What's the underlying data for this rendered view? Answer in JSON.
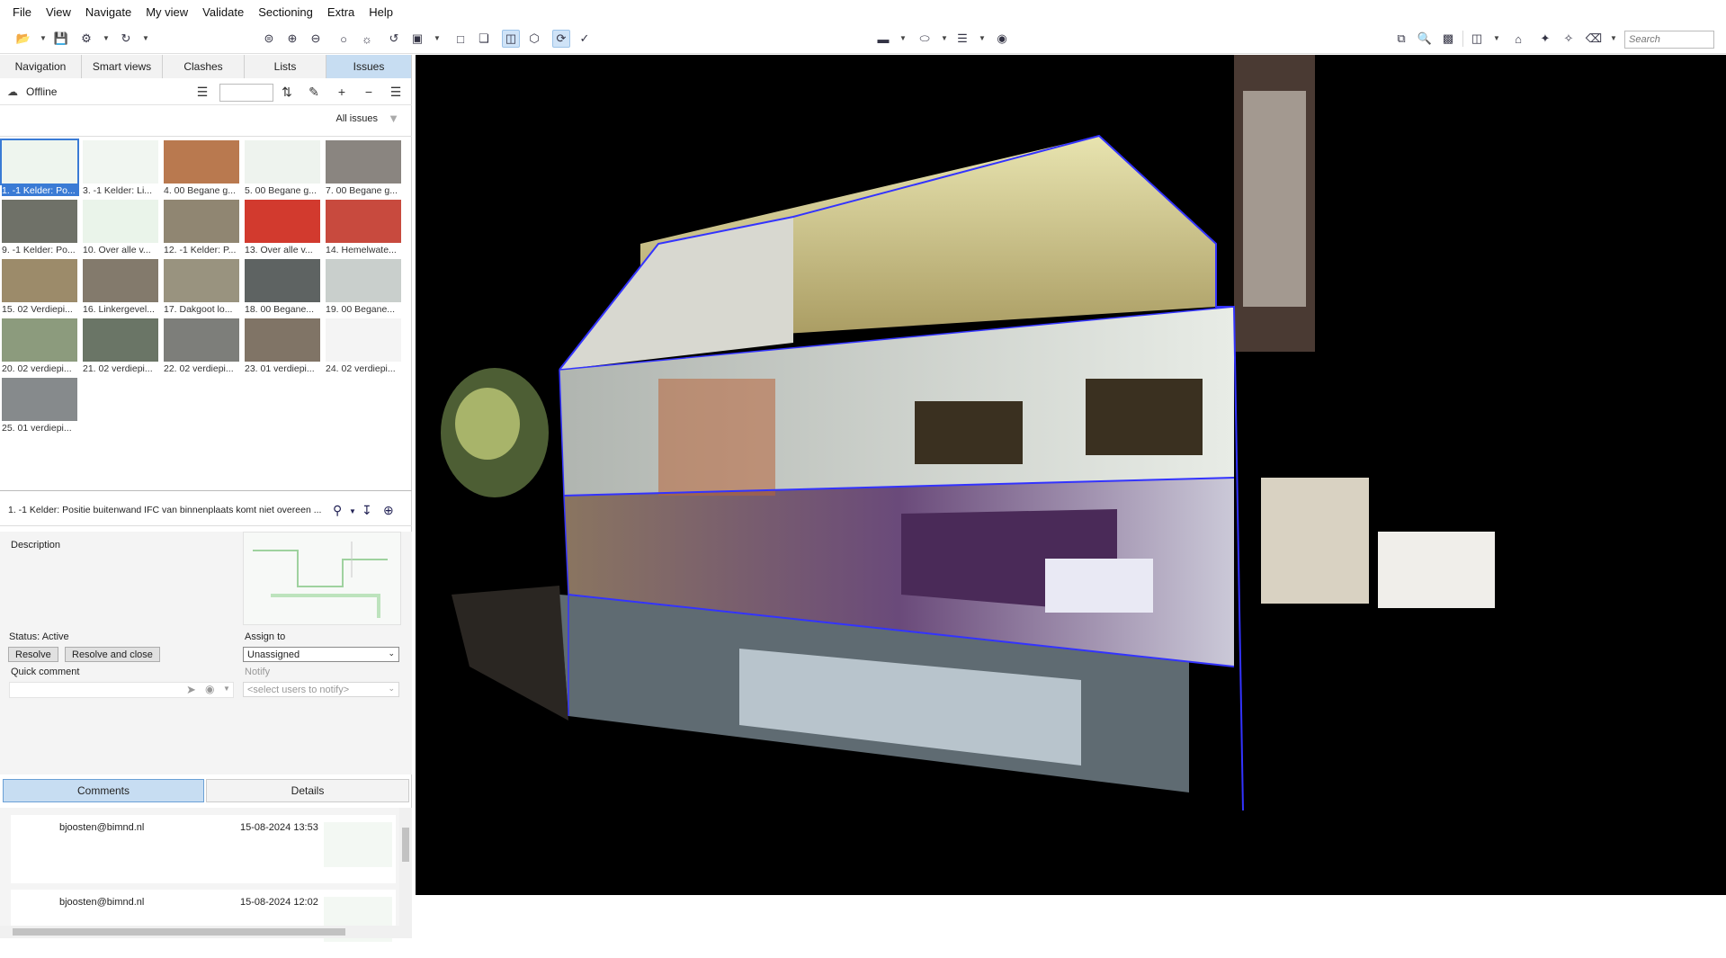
{
  "menu": [
    "File",
    "View",
    "Navigate",
    "My view",
    "Validate",
    "Sectioning",
    "Extra",
    "Help"
  ],
  "toolbar": {
    "search_placeholder": "Search"
  },
  "tabs": [
    {
      "label": "Navigation",
      "active": false
    },
    {
      "label": "Smart views",
      "active": false
    },
    {
      "label": "Clashes",
      "active": false
    },
    {
      "label": "Lists",
      "active": false
    },
    {
      "label": "Issues",
      "active": true
    }
  ],
  "status": {
    "connection": "Offline"
  },
  "filter": {
    "label": "All issues"
  },
  "issues": [
    "1. -1 Kelder: Po...",
    "3. -1 Kelder: Li...",
    "4. 00 Begane g...",
    "5. 00 Begane g...",
    "7. 00 Begane g...",
    "9. -1 Kelder: Po...",
    "10. Over alle v...",
    "12. -1 Kelder: P...",
    "13. Over alle v...",
    "14. Hemelwate...",
    "15. 02 Verdiepi...",
    "16. Linkergevel...",
    "17. Dakgoot lo...",
    "18. 00 Begane...",
    "19. 00 Begane...",
    "20. 02 verdiepi...",
    "21. 02 verdiepi...",
    "22. 02 verdiepi...",
    "23. 01 verdiepi...",
    "24. 02 verdiepi...",
    "25. 01 verdiepi..."
  ],
  "selected_issue": {
    "title": "1. -1 Kelder: Positie buitenwand IFC van binnenplaats komt niet overeen ...",
    "description_label": "Description",
    "status": "Status: Active",
    "assign_label": "Assign to",
    "assignee": "Unassigned",
    "resolve": "Resolve",
    "resolve_close": "Resolve and close",
    "quick_comment": "Quick comment",
    "notify_label": "Notify",
    "notify_placeholder": "<select users to notify>"
  },
  "comment_tabs": [
    {
      "label": "Comments",
      "active": true
    },
    {
      "label": "Details",
      "active": false
    }
  ],
  "comments": [
    {
      "user": "bjoosten@bimnd.nl",
      "date": "15-08-2024 13:53"
    },
    {
      "user": "bjoosten@bimnd.nl",
      "date": "15-08-2024 12:02"
    }
  ],
  "icons": {
    "cloud": "cloud-icon",
    "list": "list-icon",
    "sort": "sort-icon",
    "edit": "pencil-icon",
    "add": "plus-icon",
    "remove": "minus-icon",
    "menu": "hamburger-icon",
    "filter": "funnel-icon"
  },
  "colors": {
    "accent": "#3a7bd5",
    "tab_active": "#c7ddf2",
    "viewport_bg": "#000000"
  }
}
